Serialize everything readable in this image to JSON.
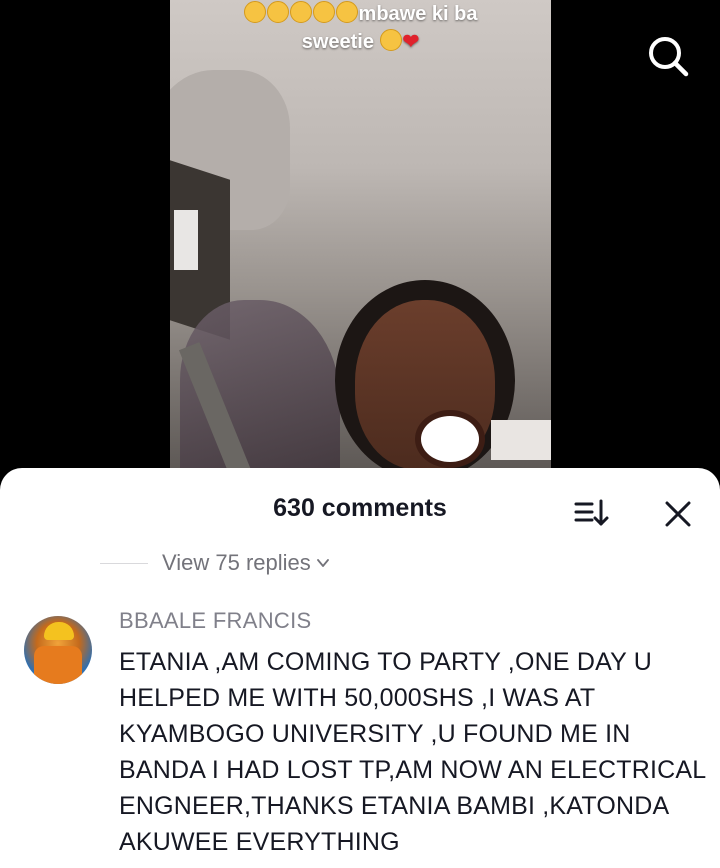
{
  "video": {
    "caption_line1": "mbawe ki ba",
    "caption_line2": "sweetie",
    "caption_emoji_prefix": "😂😂😂😂😂",
    "caption_emoji_suffix": "🥺❤️"
  },
  "header": {
    "search_icon": "search-icon"
  },
  "comments_sheet": {
    "title": "630 comments",
    "sort_icon": "sort-icon",
    "close_icon": "close-icon",
    "view_replies_label": "View 75 replies",
    "comment": {
      "username": "BBAALE FRANCIS",
      "text": "ETANIA ,AM COMING TO PARTY ,ONE DAY U HELPED ME WITH 50,000SHS ,I WAS AT KYAMBOGO UNIVERSITY ,U FOUND ME IN BANDA I HAD LOST TP,AM NOW AN ELECTRICAL ENGNEER,THANKS ETANIA BAMBI ,KATONDA AKUWEE EVERYTHING"
    }
  },
  "colors": {
    "sheet_bg": "#ffffff",
    "primary_text": "#161823",
    "secondary_text": "#73737a"
  }
}
